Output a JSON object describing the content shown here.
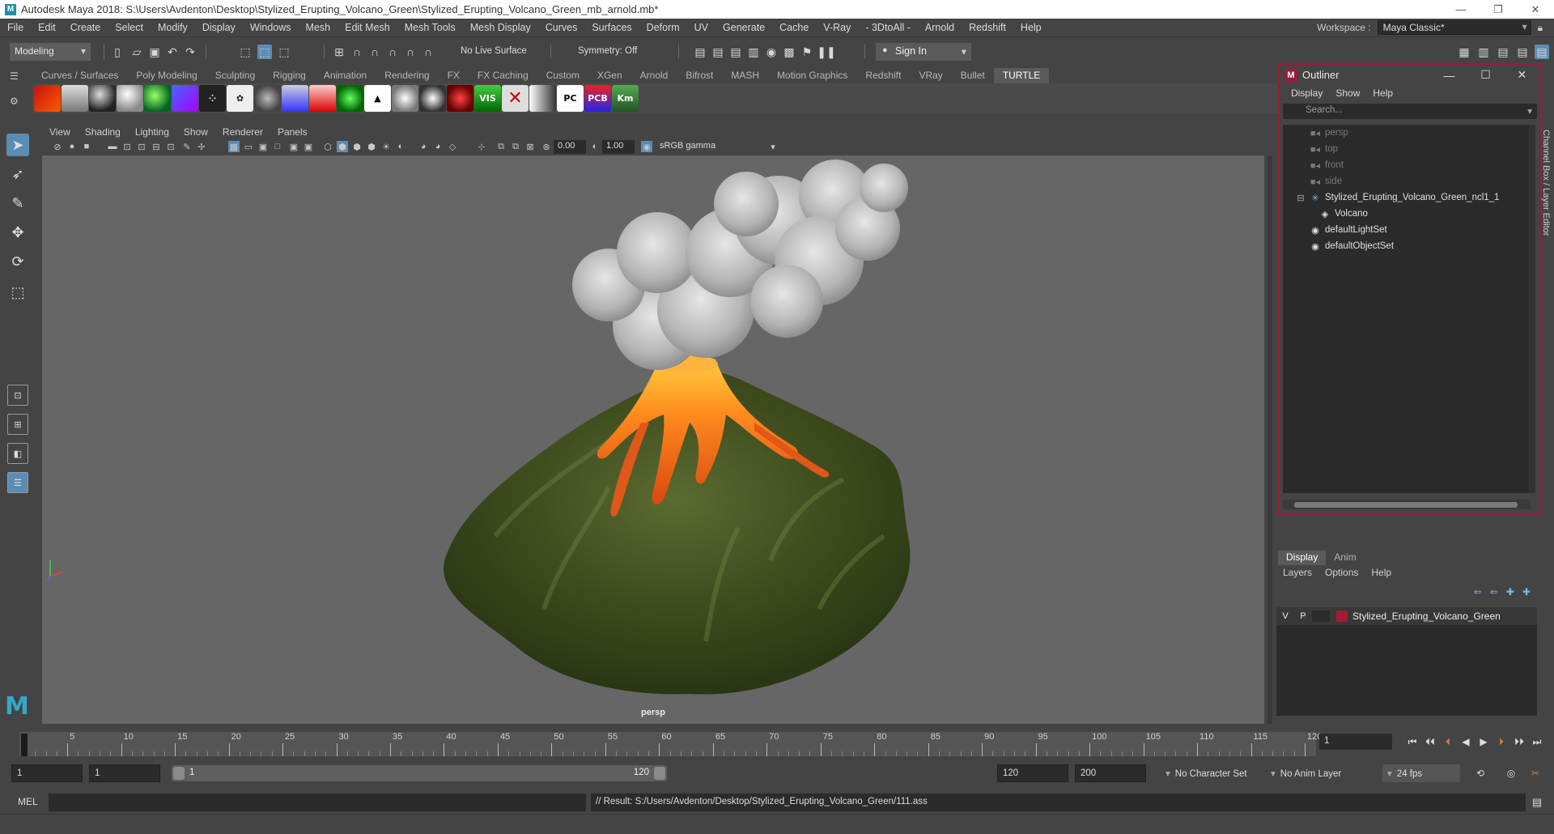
{
  "window": {
    "title": "Autodesk Maya 2018: S:\\Users\\Avdenton\\Desktop\\Stylized_Erupting_Volcano_Green\\Stylized_Erupting_Volcano_Green_mb_arnold.mb*",
    "app_icon": "M"
  },
  "menubar": {
    "items": [
      "File",
      "Edit",
      "Create",
      "Select",
      "Modify",
      "Display",
      "Windows",
      "Mesh",
      "Edit Mesh",
      "Mesh Tools",
      "Mesh Display",
      "Curves",
      "Surfaces",
      "Deform",
      "UV",
      "Generate",
      "Cache",
      "V-Ray",
      "- 3DtoAll -",
      "Arnold",
      "Redshift",
      "Help"
    ],
    "workspace_label": "Workspace :",
    "workspace_value": "Maya Classic*"
  },
  "statusline": {
    "mode": "Modeling",
    "live_surface": "No Live Surface",
    "symmetry": "Symmetry: Off",
    "sign_in": "Sign In"
  },
  "shelf": {
    "tabs": [
      "Curves / Surfaces",
      "Poly Modeling",
      "Sculpting",
      "Rigging",
      "Animation",
      "Rendering",
      "FX",
      "FX Caching",
      "Custom",
      "XGen",
      "Arnold",
      "Bifrost",
      "MASH",
      "Motion Graphics",
      "Redshift",
      "VRay",
      "Bullet",
      "TURTLE"
    ],
    "active_tab": "TURTLE",
    "icon_labels": {
      "vis": "VIS",
      "pc": "PC",
      "pcb": "PCB",
      "km": "Km"
    }
  },
  "viewport": {
    "menu": [
      "View",
      "Shading",
      "Lighting",
      "Show",
      "Renderer",
      "Panels"
    ],
    "exposure": "0.00",
    "gamma": "1.00",
    "colorspace": "sRGB gamma",
    "camera": "persp"
  },
  "outliner": {
    "title": "Outliner",
    "menu": [
      "Display",
      "Show",
      "Help"
    ],
    "search_placeholder": "Search...",
    "items": [
      {
        "label": "persp",
        "icon": "camera-icon",
        "dim": true,
        "indent": 1
      },
      {
        "label": "top",
        "icon": "camera-icon",
        "dim": true,
        "indent": 1
      },
      {
        "label": "front",
        "icon": "camera-icon",
        "dim": true,
        "indent": 1
      },
      {
        "label": "side",
        "icon": "camera-icon",
        "dim": true,
        "indent": 1
      },
      {
        "label": "Stylized_Erupting_Volcano_Green_ncl1_1",
        "icon": "joint-icon",
        "dim": false,
        "indent": 1
      },
      {
        "label": "Volcano",
        "icon": "mesh-icon",
        "dim": false,
        "indent": 2
      },
      {
        "label": "defaultLightSet",
        "icon": "set-icon",
        "dim": false,
        "indent": 1
      },
      {
        "label": "defaultObjectSet",
        "icon": "set-icon",
        "dim": false,
        "indent": 1
      }
    ]
  },
  "side_label": "Channel Box / Layer Editor",
  "layer_editor": {
    "tabs": [
      "Display",
      "Anim"
    ],
    "menu": [
      "Layers",
      "Options",
      "Help"
    ],
    "layers": [
      {
        "v": "V",
        "p": "P",
        "name": "Stylized_Erupting_Volcano_Green",
        "color": "#a01d35"
      }
    ]
  },
  "timeline": {
    "ticks": [
      "1",
      "5",
      "10",
      "15",
      "20",
      "25",
      "30",
      "35",
      "40",
      "45",
      "50",
      "55",
      "60",
      "65",
      "70",
      "75",
      "80",
      "85",
      "90",
      "95",
      "100",
      "105",
      "110",
      "115",
      "120"
    ],
    "current_frame": "1"
  },
  "range": {
    "start": "1",
    "anim_start": "1",
    "slider_start": "1",
    "slider_end": "120",
    "anim_end_field": "120",
    "end": "200",
    "character_set": "No Character Set",
    "anim_layer": "No Anim Layer",
    "fps": "24 fps"
  },
  "command": {
    "mel_label": "MEL",
    "result": "// Result: S:/Users/Avdenton/Desktop/Stylized_Erupting_Volcano_Green/111.ass"
  },
  "colors": {
    "accent_selected": "#5b8cb3",
    "outliner_border": "#9b1b3b",
    "viewport_bg": "#666666",
    "layer_color": "#a01d35"
  }
}
